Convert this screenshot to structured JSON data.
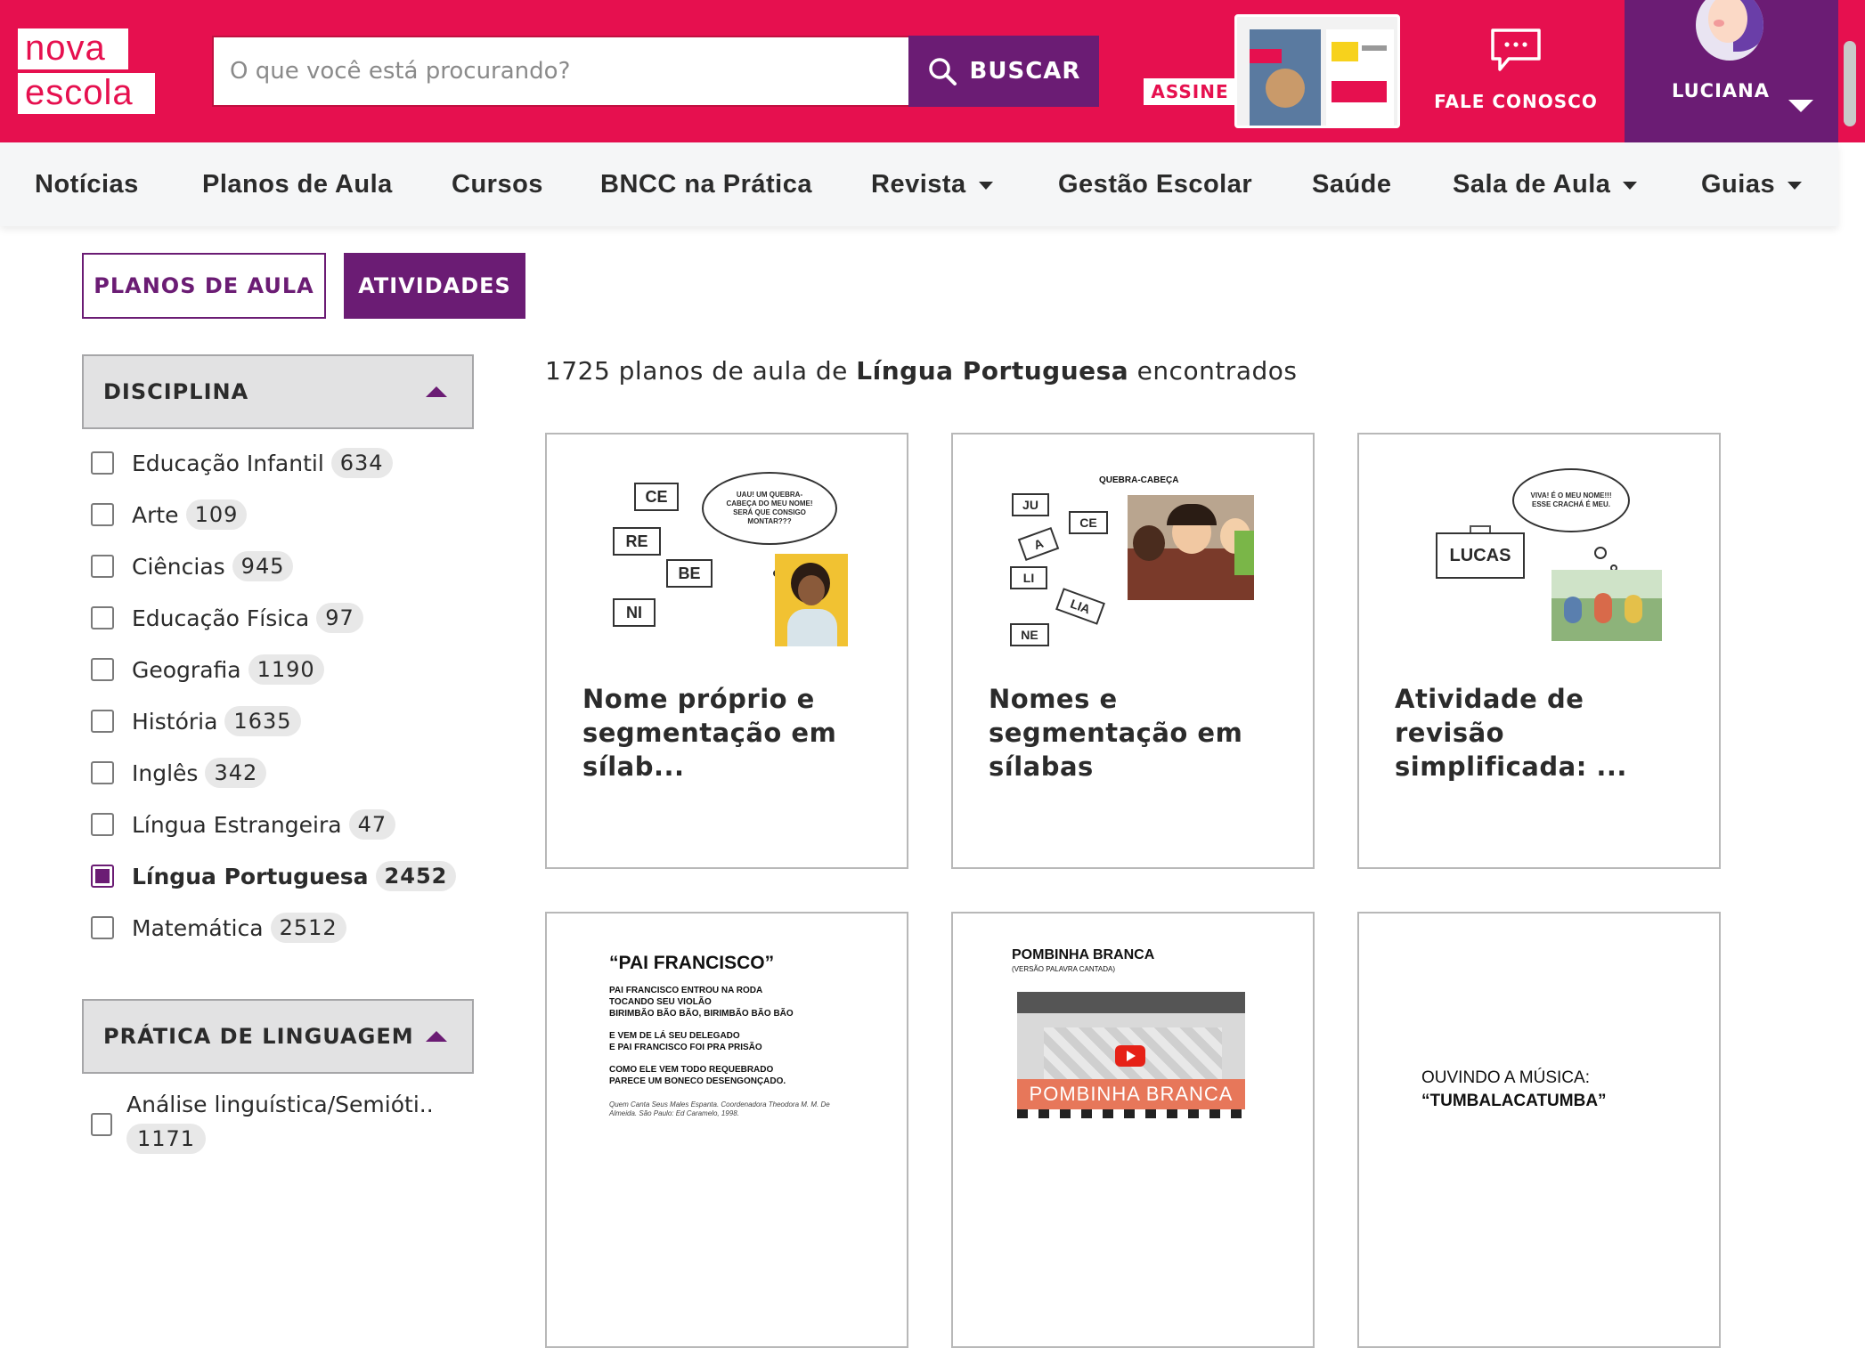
{
  "header": {
    "logo_line1": "nova",
    "logo_line2": "escola",
    "search_placeholder": "O que você está procurando?",
    "search_button": "BUSCAR",
    "subscribe_label": "ASSINE",
    "contact_label": "FALE CONOSCO",
    "user_name": "LUCIANA"
  },
  "nav": {
    "items": [
      {
        "label": "Notícias"
      },
      {
        "label": "Planos de Aula"
      },
      {
        "label": "Cursos"
      },
      {
        "label": "BNCC na Prática"
      },
      {
        "label": "Revista"
      },
      {
        "label": "Gestão Escolar"
      },
      {
        "label": "Saúde"
      },
      {
        "label": "Sala de Aula"
      },
      {
        "label": "Guias"
      }
    ]
  },
  "tabs": {
    "planos": "PLANOS DE AULA",
    "atividades": "ATIVIDADES"
  },
  "filters": {
    "disciplina_title": "DISCIPLINA",
    "disciplina_options": [
      {
        "label": "Educação Infantil",
        "count": "634",
        "checked": false
      },
      {
        "label": "Arte",
        "count": "109",
        "checked": false
      },
      {
        "label": "Ciências",
        "count": "945",
        "checked": false
      },
      {
        "label": "Educação Física",
        "count": "97",
        "checked": false
      },
      {
        "label": "Geografia",
        "count": "1190",
        "checked": false
      },
      {
        "label": "História",
        "count": "1635",
        "checked": false
      },
      {
        "label": "Inglês",
        "count": "342",
        "checked": false
      },
      {
        "label": "Língua Estrangeira",
        "count": "47",
        "checked": false
      },
      {
        "label": "Língua Portuguesa",
        "count": "2452",
        "checked": true
      },
      {
        "label": "Matemática",
        "count": "2512",
        "checked": false
      }
    ],
    "pratica_title": "PRÁTICA DE LINGUAGEM",
    "pratica_options": [
      {
        "label": "Análise linguística/Semióti..",
        "count": "1171"
      }
    ]
  },
  "results": {
    "count_prefix": "1725 planos de aula de ",
    "count_subject": "Língua Portuguesa",
    "count_suffix": " encontrados",
    "cards": [
      {
        "title": "Nome próprio e segmentação em sílab...",
        "thumb": {
          "syllables": [
            "CE",
            "RE",
            "BE",
            "NI"
          ],
          "thought": "UAU! UM QUEBRA-CABEÇA DO MEU NOME! SERÁ QUE CONSIGO MONTAR???"
        }
      },
      {
        "title": "Nomes e segmentação em sílabas",
        "thumb": {
          "heading": "QUEBRA-CABEÇA",
          "syllables": [
            "JU",
            "CE",
            "A",
            "LI",
            "LIA",
            "NE"
          ]
        }
      },
      {
        "title": "Atividade de revisão simplificada: ...",
        "thumb": {
          "badge": "LUCAS",
          "thought": "VIVA! É O MEU NOME!!! ESSE CRACHÁ É MEU."
        }
      },
      {
        "title": "",
        "thumb": {
          "heading": "“PAI FRANCISCO”",
          "lines": [
            "PAI FRANCISCO ENTROU NA RODA",
            "TOCANDO SEU VIOLÃO",
            "BIRIMBÃO BÃO BÃO, BIRIMBÃO BÃO BÃO",
            "E VEM DE LÁ SEU DELEGADO",
            "E PAI FRANCISCO FOI PRA PRISÃO",
            "COMO ELE VEM TODO REQUEBRADO",
            "PARECE UM BONECO DESENGONÇADO."
          ],
          "credit": "Quem Canta Seus Males Espanta. Coordenadora Theodora M. M. De Almeida. São Paulo: Ed Caramelo, 1998."
        }
      },
      {
        "title": "",
        "thumb": {
          "heading": "POMBINHA BRANCA",
          "sub": "(VERSÃO PALAVRA CANTADA)",
          "video_title": "POMBINHA BRANCA"
        }
      },
      {
        "title": "",
        "thumb": {
          "line1": "OUVINDO A MÚSICA:",
          "line2": "“TUMBALACATUMBA”"
        }
      }
    ]
  },
  "colors": {
    "brand_pink": "#e6104f",
    "brand_purple": "#6b1c74"
  }
}
